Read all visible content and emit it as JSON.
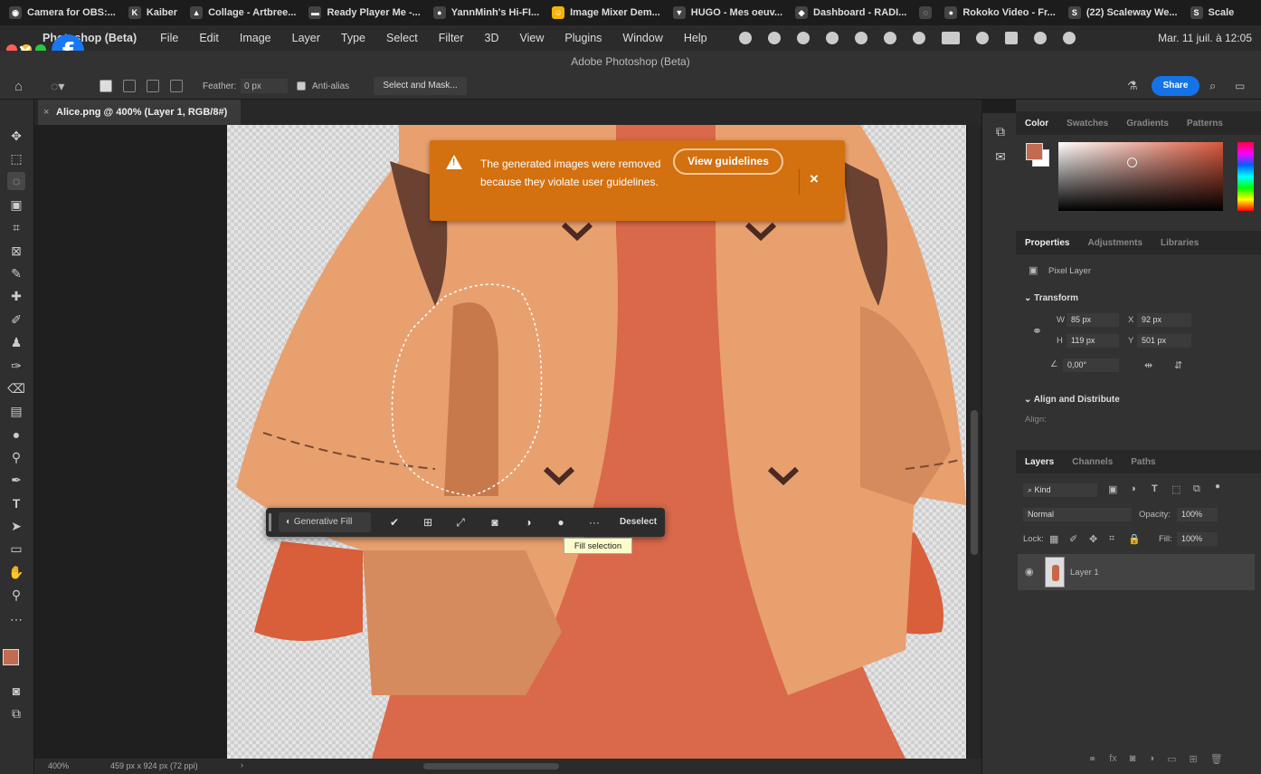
{
  "browser_tabs": [
    {
      "label": "Camera for OBS:...",
      "icon": "camera-icon"
    },
    {
      "label": "Kaiber",
      "icon": "k-icon"
    },
    {
      "label": "Collage - Artbree...",
      "icon": "artbreeder-icon"
    },
    {
      "label": "Ready Player Me -...",
      "icon": "rpm-icon"
    },
    {
      "label": "YannMinh's Hi-FI...",
      "icon": "github-icon"
    },
    {
      "label": "Image Mixer Dem...",
      "icon": "hf-icon"
    },
    {
      "label": "HUGO - Mes oeuv...",
      "icon": "hugo-icon"
    },
    {
      "label": "Dashboard - RADI...",
      "icon": "radi-icon"
    },
    {
      "label": "",
      "icon": "circle-icon"
    },
    {
      "label": "Rokoko Video - Fr...",
      "icon": "rokoko-icon"
    },
    {
      "label": "(22) Scaleway We...",
      "icon": "scaleway-icon"
    },
    {
      "label": "Scale",
      "icon": "scale-icon"
    }
  ],
  "menubar": {
    "app_name": "Photoshop (Beta)",
    "items": [
      "File",
      "Edit",
      "Image",
      "Layer",
      "Type",
      "Select",
      "Filter",
      "3D",
      "View",
      "Plugins",
      "Window",
      "Help"
    ],
    "clock": "Mar. 11 juil. à 12:05"
  },
  "window_title": "Adobe Photoshop (Beta)",
  "options_bar": {
    "feather_label": "Feather:",
    "feather_value": "0 px",
    "anti_alias_label": "Anti-alias",
    "select_mask_label": "Select and Mask...",
    "share_label": "Share"
  },
  "document_tab": {
    "label": "Alice.png @ 400% (Layer 1, RGB/8#)",
    "close": "×"
  },
  "alert": {
    "message": "The generated images were removed because they violate user guidelines.",
    "button_label": "View guidelines",
    "close": "×"
  },
  "context_bar": {
    "generative_fill_label": "Generative Fill",
    "more": "···",
    "deselect_label": "Deselect"
  },
  "tooltip": "Fill selection",
  "status_bar": {
    "zoom": "400%",
    "doc_info": "459 px x 924 px (72 ppi)",
    "arrow": "›"
  },
  "color_panel": {
    "tabs": [
      "Color",
      "Swatches",
      "Gradients",
      "Patterns"
    ],
    "foreground": "#c26a52",
    "background": "#ffffff"
  },
  "properties_panel": {
    "tabs": [
      "Properties",
      "Adjustments",
      "Libraries"
    ],
    "layer_type": "Pixel Layer",
    "transform_title": "Transform",
    "w_label": "W",
    "w_value": "85 px",
    "x_label": "X",
    "x_value": "92 px",
    "h_label": "H",
    "h_value": "119 px",
    "y_label": "Y",
    "y_value": "501 px",
    "angle_value": "0,00°",
    "align_title": "Align and Distribute",
    "align_label": "Align:"
  },
  "layers_panel": {
    "tabs": [
      "Layers",
      "Channels",
      "Paths"
    ],
    "kind_label": "Kind",
    "blend_mode": "Normal",
    "opacity_label": "Opacity:",
    "opacity_value": "100%",
    "lock_label": "Lock:",
    "fill_label": "Fill:",
    "fill_value": "100%",
    "layer_name": "Layer 1"
  },
  "colors": {
    "accent_blue": "#1473e6",
    "alert_orange": "#d3700f"
  }
}
